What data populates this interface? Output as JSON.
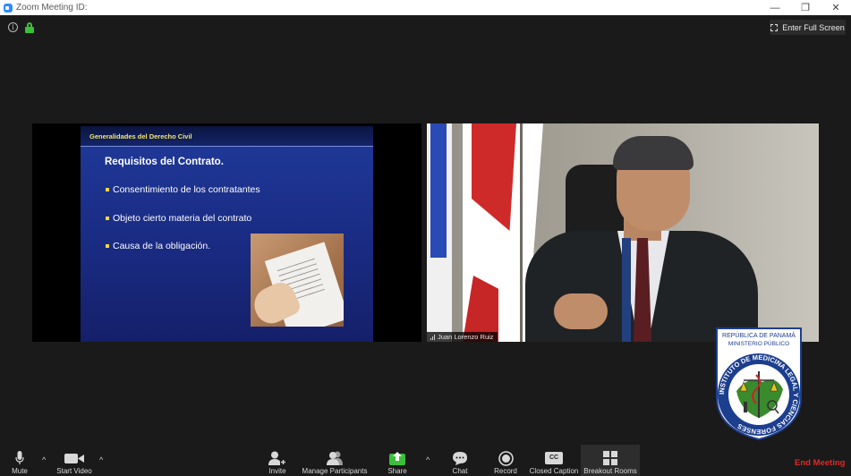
{
  "window": {
    "title": "Zoom Meeting ID:",
    "minimize_glyph": "—",
    "restore_glyph": "❐",
    "close_glyph": "✕"
  },
  "top_bar": {
    "info_glyph": "i",
    "fullscreen_label": "Enter Full Screen"
  },
  "slide": {
    "header": "Generalidades del Derecho Civil",
    "title": "Requisitos del Contrato.",
    "bullets": [
      "Consentimiento de los contratantes",
      "Objeto cierto materia del contrato",
      "Causa de la obligación."
    ]
  },
  "video": {
    "participant_name": "Juan Lorenzo Ruiz"
  },
  "emblem": {
    "line1": "REPÚBLICA DE PANAMÁ",
    "line2": "MINISTERIO PÚBLICO",
    "ring_text": "INSTITUTO DE MEDICINA LEGAL Y CIENCIAS FORENSES"
  },
  "toolbar": {
    "mute": "Mute",
    "start_video": "Start Video",
    "invite": "Invite",
    "manage_participants": "Manage Participants",
    "share": "Share",
    "chat": "Chat",
    "record": "Record",
    "closed_caption": "Closed Caption",
    "cc_glyph": "CC",
    "breakout_rooms": "Breakout Rooms",
    "end_meeting": "End Meeting",
    "chevron_glyph": "^"
  },
  "colors": {
    "accent": "#2d8cff",
    "share_green": "#3bbf3b",
    "end_red": "#e02828",
    "slide_blue": "#1f3a99",
    "slide_header_text": "#f5e66a"
  }
}
